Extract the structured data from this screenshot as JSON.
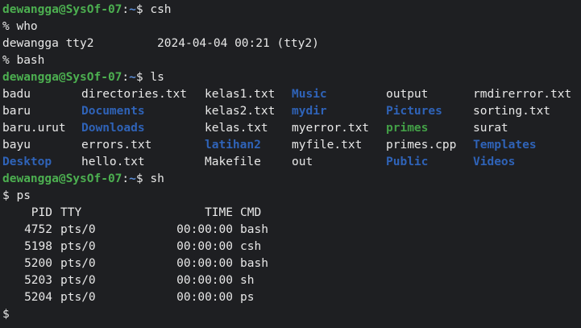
{
  "window": {
    "background": "#1e1f22",
    "text_color": "#e8e8e8"
  },
  "colors": {
    "user": "#4caf50",
    "directory": "#2f63b8",
    "executable": "#43a047",
    "tilde": "#5c8dd6"
  },
  "prompt": {
    "user_host": "dewangga@SysOf-07",
    "colon": ":",
    "tilde": "~",
    "symbol": "$"
  },
  "lines": {
    "l1_cmd": "csh",
    "l2": "% who",
    "l3": "dewangga tty2         2024-04-04 00:21 (tty2)",
    "l4": "% bash",
    "l5_cmd": "ls"
  },
  "ls": {
    "rows": [
      [
        {
          "name": "badu",
          "type": "file"
        },
        {
          "name": "directories.txt",
          "type": "file"
        },
        {
          "name": "kelas1.txt",
          "type": "file"
        },
        {
          "name": "Music",
          "type": "dir"
        },
        {
          "name": "output",
          "type": "file"
        },
        {
          "name": "rmdirerror.txt",
          "type": "file"
        }
      ],
      [
        {
          "name": "baru",
          "type": "file"
        },
        {
          "name": "Documents",
          "type": "dir"
        },
        {
          "name": "kelas2.txt",
          "type": "file"
        },
        {
          "name": "mydir",
          "type": "dir"
        },
        {
          "name": "Pictures",
          "type": "dir"
        },
        {
          "name": "sorting.txt",
          "type": "file"
        }
      ],
      [
        {
          "name": "baru.urut",
          "type": "file"
        },
        {
          "name": "Downloads",
          "type": "dir"
        },
        {
          "name": "kelas.txt",
          "type": "file"
        },
        {
          "name": "myerror.txt",
          "type": "file"
        },
        {
          "name": "primes",
          "type": "exec"
        },
        {
          "name": "surat",
          "type": "file"
        }
      ],
      [
        {
          "name": "bayu",
          "type": "file"
        },
        {
          "name": "errors.txt",
          "type": "file"
        },
        {
          "name": "latihan2",
          "type": "dir"
        },
        {
          "name": "myfile.txt",
          "type": "file"
        },
        {
          "name": "primes.cpp",
          "type": "file"
        },
        {
          "name": "Templates",
          "type": "dir"
        }
      ],
      [
        {
          "name": "Desktop",
          "type": "dir"
        },
        {
          "name": "hello.txt",
          "type": "file"
        },
        {
          "name": "Makefile",
          "type": "file"
        },
        {
          "name": "out",
          "type": "file"
        },
        {
          "name": "Public",
          "type": "dir"
        },
        {
          "name": "Videos",
          "type": "dir"
        }
      ]
    ]
  },
  "l11_cmd": "sh",
  "l12": "$ ps",
  "ps": {
    "header": {
      "pid": "PID",
      "tty": "TTY",
      "time": "TIME",
      "cmd": "CMD"
    },
    "rows": [
      {
        "pid": "4752",
        "tty": "pts/0",
        "time": "00:00:00",
        "cmd": "bash"
      },
      {
        "pid": "5198",
        "tty": "pts/0",
        "time": "00:00:00",
        "cmd": "csh"
      },
      {
        "pid": "5200",
        "tty": "pts/0",
        "time": "00:00:00",
        "cmd": "bash"
      },
      {
        "pid": "5203",
        "tty": "pts/0",
        "time": "00:00:00",
        "cmd": "sh"
      },
      {
        "pid": "5204",
        "tty": "pts/0",
        "time": "00:00:00",
        "cmd": "ps"
      }
    ]
  },
  "last_prompt": "$"
}
